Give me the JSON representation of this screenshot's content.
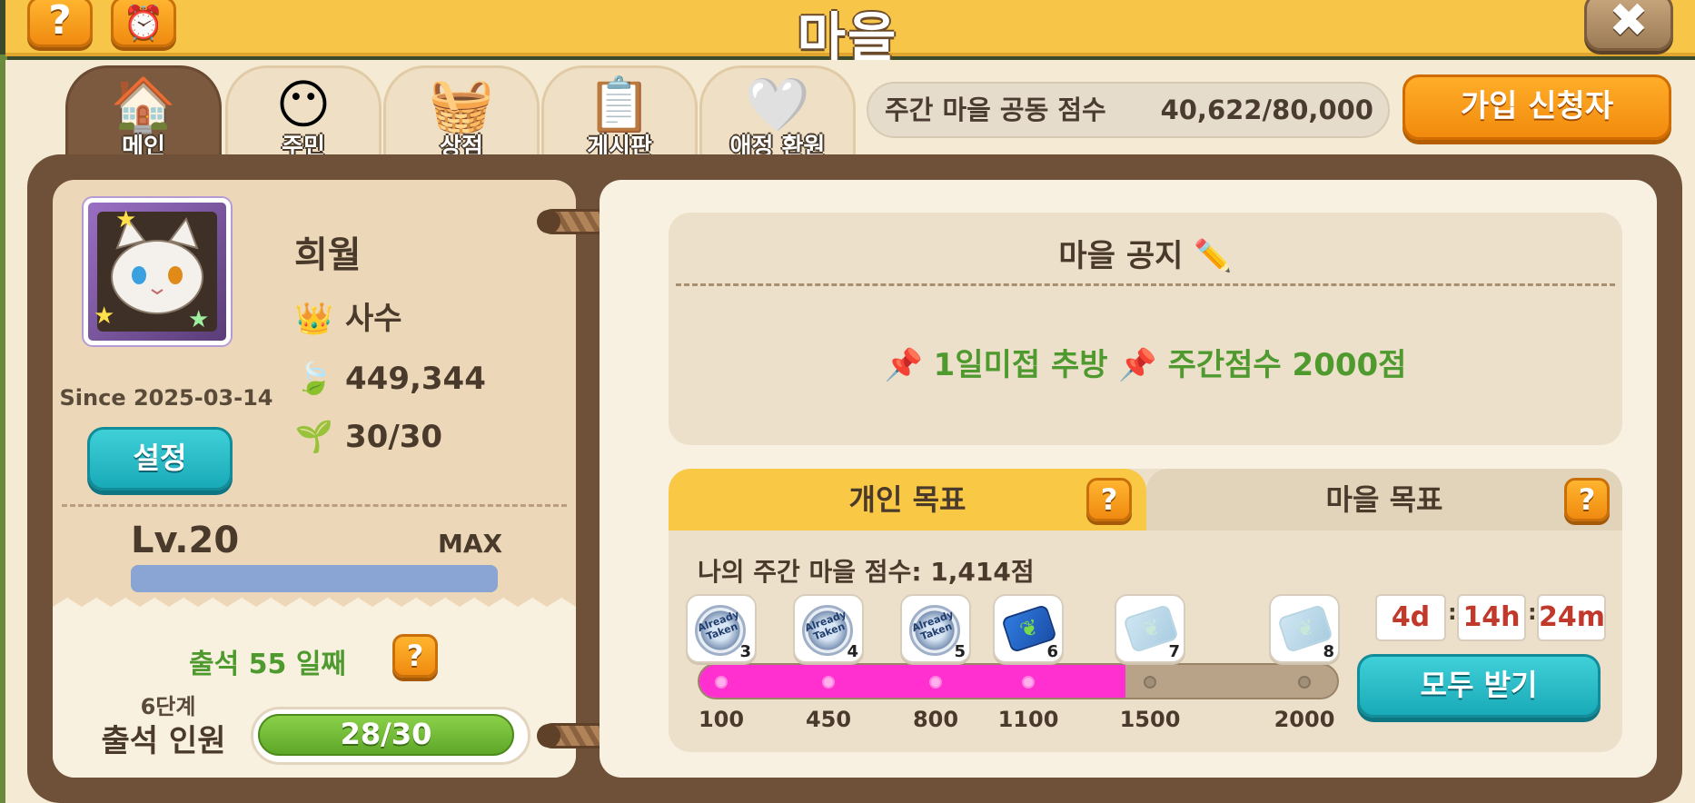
{
  "header": {
    "title": "마을",
    "help_label": "?",
    "close_label": "✖",
    "alarm_icon": "⏰"
  },
  "tabs": [
    {
      "label": "메인",
      "icon": "🏠",
      "active": true
    },
    {
      "label": "주민",
      "icon": "😶",
      "active": false
    },
    {
      "label": "상점",
      "icon": "🧺",
      "active": false
    },
    {
      "label": "게시판",
      "icon": "📋",
      "active": false
    },
    {
      "label": "애정 환원",
      "icon": "🤍",
      "active": false
    }
  ],
  "weekly_score": {
    "label": "주간 마을 공동 점수",
    "value": "40,622/80,000"
  },
  "join_button": "가입 신청자",
  "profile": {
    "name": "희월",
    "since": "Since 2025-03-14",
    "settings_label": "설정",
    "role": "사수",
    "leaves": "449,344",
    "members": "30/30",
    "level": "Lv.20",
    "max_label": "MAX",
    "level_progress": 1.0,
    "role_icon": "👑",
    "leaf_icon": "🍃",
    "member_icon": "🌱"
  },
  "attendance": {
    "text": "출석 55 일째",
    "help_label": "?",
    "stage": "6단계",
    "label": "출석 인원",
    "value": "28/30",
    "progress": 0.9333
  },
  "notice": {
    "title": "마을 공지",
    "title_icon": "✏️",
    "body": "📌 1일미접 추방 📌 주간점수 2000점"
  },
  "goals": {
    "personal_tab": "개인 목표",
    "village_tab": "마을 목표",
    "help_label": "?",
    "my_score_label": "나의 주간 마을 점수: 1,414점",
    "my_score": 1414,
    "timer": {
      "days": "4d",
      "hours": "14h",
      "minutes": "24m"
    },
    "claim_label": "모두 받기",
    "milestones": [
      {
        "score": "100",
        "reward": "3",
        "state": "taken"
      },
      {
        "score": "450",
        "reward": "4",
        "state": "taken"
      },
      {
        "score": "800",
        "reward": "5",
        "state": "taken"
      },
      {
        "score": "1100",
        "reward": "6",
        "state": "available"
      },
      {
        "score": "1500",
        "reward": "7",
        "state": "locked"
      },
      {
        "score": "2000",
        "reward": "8",
        "state": "locked"
      }
    ],
    "taken_text": "Already Taken",
    "progress_color": "#ff2fd0"
  }
}
